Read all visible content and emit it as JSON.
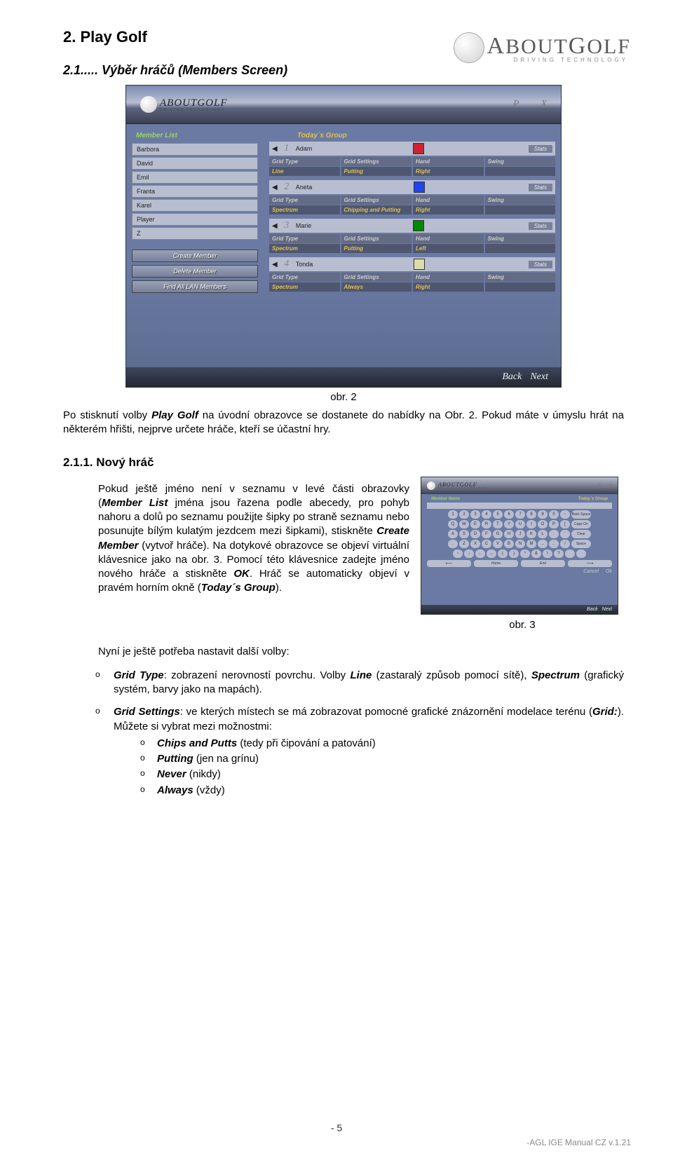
{
  "logo": {
    "brand": "ABOUTGOLF",
    "tag": "DRIVING TECHNOLOGY"
  },
  "h1": "2. Play Golf",
  "h2": "2.1..... Výběr hráčů (Members Screen)",
  "ss1": {
    "memberList": "Member List",
    "todaysGroup": "Today´s Group",
    "winP": "P",
    "winMin": "_",
    "winX": "X",
    "members": [
      "Barbora",
      "David",
      "Emil",
      "Franta",
      "Karel",
      "Player",
      "Z"
    ],
    "btnCreate": "Create Member",
    "btnDelete": "Delete Member",
    "btnFind": "Find All LAN Members",
    "hdr": {
      "gt": "Grid Type",
      "gs": "Grid Settings",
      "hand": "Hand",
      "swing": "Swing"
    },
    "stats": "Stats",
    "players": [
      {
        "num": "1",
        "name": "Adam",
        "color": "#c23",
        "v": [
          "Line",
          "Putting",
          "Right",
          ""
        ]
      },
      {
        "num": "2",
        "name": "Aneta",
        "color": "#24e",
        "v": [
          "Spectrum",
          "Chipping and Putting",
          "Right",
          ""
        ]
      },
      {
        "num": "3",
        "name": "Marie",
        "color": "#080",
        "v": [
          "Spectrum",
          "Putting",
          "Left",
          ""
        ]
      },
      {
        "num": "4",
        "name": "Tonda",
        "color": "#dda",
        "v": [
          "Spectrum",
          "Always",
          "Right",
          ""
        ]
      }
    ],
    "back": "Back",
    "next": "Next"
  },
  "caption1": "obr. 2",
  "para1a": "Po stisknutí volby ",
  "para1b": "Play Golf",
  "para1c": " na úvodní obrazovce se dostanete do nabídky na Obr. 2. Pokud máte v úmyslu hrát na některém hřišti, nejprve určete hráče, kteří se účastní hry.",
  "h3": "2.1.1. Nový hráč",
  "p211_segments": [
    {
      "t": "Pokud ještě jméno není v seznamu v levé části obrazovky ("
    },
    {
      "t": "Member List",
      "bi": true
    },
    {
      "t": " jména jsou řazena podle abecedy, pro pohyb nahoru a dolů po seznamu použijte šipky po straně seznamu nebo posunujte bílým kulatým jezdcem mezi šipkami), stiskněte "
    },
    {
      "t": "Create Member",
      "bi": true
    },
    {
      "t": " (vytvoř hráče). Na dotykové obrazovce se objeví virtuální klávesnice jako na obr. 3. Pomocí této klávesnice zadejte jméno nového hráče a stiskněte "
    },
    {
      "t": "OK",
      "bi": true
    },
    {
      "t": ". Hráč se automaticky objeví v pravém horním okně ("
    },
    {
      "t": "Today´s Group",
      "bi": true
    },
    {
      "t": ")."
    }
  ],
  "ss2": {
    "memberName": "Member Name",
    "todaysGroup": "Today´s Group",
    "rows": [
      [
        "1",
        "2",
        "3",
        "4",
        "5",
        "6",
        "7",
        "8",
        "9",
        "0",
        "-",
        "Back Space"
      ],
      [
        "Q",
        "W",
        "E",
        "R",
        "T",
        "Y",
        "U",
        "I",
        "O",
        "P",
        "[",
        "Caps On"
      ],
      [
        "A",
        "S",
        "D",
        "F",
        "G",
        "H",
        "J",
        "K",
        "L",
        ":",
        "'",
        "Clear"
      ],
      [
        ".",
        "Z",
        "X",
        "C",
        "V",
        "B",
        "N",
        "M",
        ",",
        ";",
        "/",
        "Space"
      ],
      [
        "↑",
        "↓",
        "←",
        "→",
        "(",
        ")",
        "*",
        "&",
        "!",
        "?",
        "",
        ""
      ]
    ],
    "arrows": [
      "⟵",
      "Home",
      "End",
      "⟶"
    ],
    "cancel": "Cancel",
    "ok": "Ok",
    "back": "Back",
    "next": "Next"
  },
  "caption2": "obr. 3",
  "below": "Nyní je ještě potřeba nastavit další volby:",
  "opt1": {
    "a": "Grid Type",
    "b": ": zobrazení nerovností povrchu. Volby ",
    "c": "Line",
    "d": " (zastaralý způsob pomocí sítě), ",
    "e": "Spectrum",
    "f": " (grafický systém, barvy jako na mapách)."
  },
  "opt2": {
    "a": "Grid Settings",
    "b": ": ve kterých místech se má zobrazovat pomocné grafické znázornění modelace terénu (",
    "c": "Grid:",
    "d": "). Můžete si vybrat mezi možnostmi:"
  },
  "subs": [
    {
      "a": "Chips and Putts",
      "b": " (tedy při čipování a patování)"
    },
    {
      "a": "Putting",
      "b": " (jen na grínu)"
    },
    {
      "a": "Never",
      "b": " (nikdy)"
    },
    {
      "a": "Always",
      "b": " (vždy)"
    }
  ],
  "pageNum": "- 5",
  "footer": "-AGL IGE Manual CZ v.1.21"
}
